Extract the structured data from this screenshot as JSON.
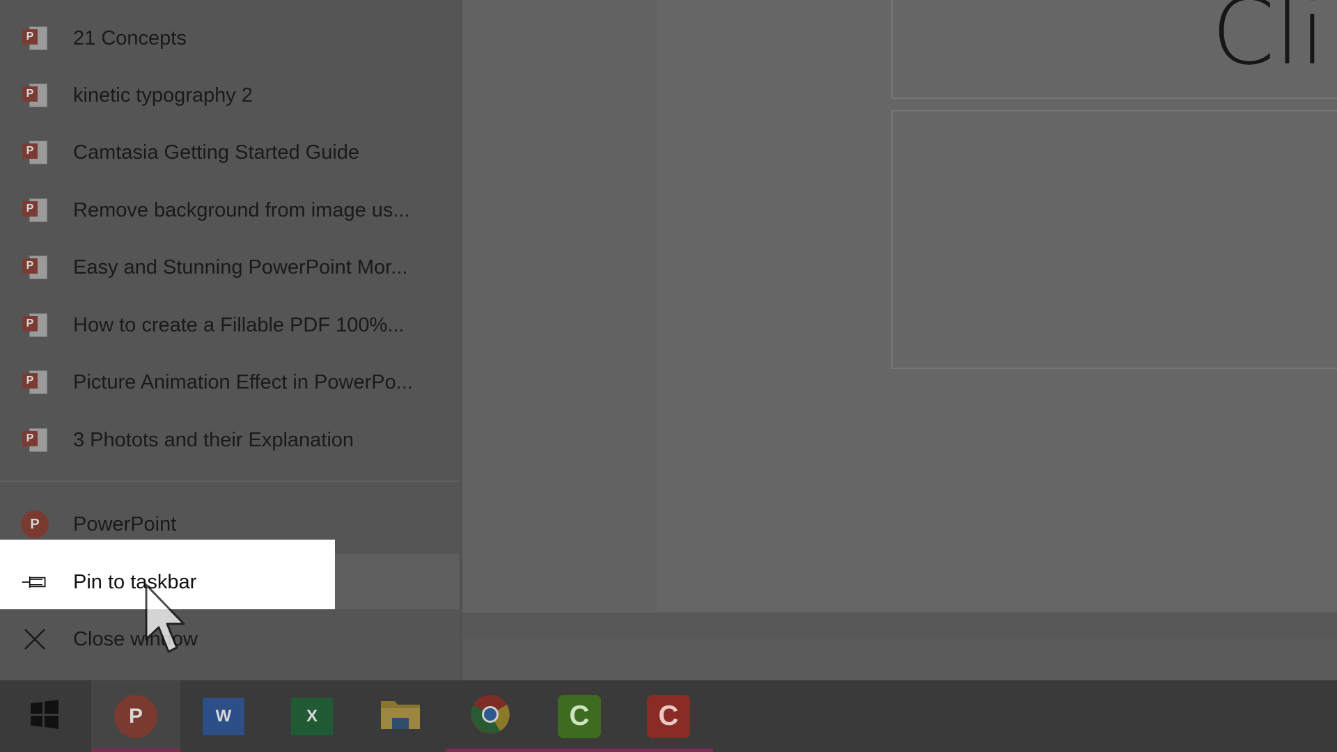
{
  "slide": {
    "title_fragment": "Cli"
  },
  "jumplist": {
    "recent": [
      {
        "label": "21 Concepts"
      },
      {
        "label": "kinetic typography 2"
      },
      {
        "label": "Camtasia Getting Started Guide"
      },
      {
        "label": "Remove background from image us..."
      },
      {
        "label": "Easy and Stunning PowerPoint Mor..."
      },
      {
        "label": "How to create a Fillable PDF 100%..."
      },
      {
        "label": "Picture Animation Effect in PowerPo..."
      },
      {
        "label": "3 Photots and their Explanation"
      }
    ],
    "app_label": "PowerPoint",
    "pin_label": "Pin to taskbar",
    "close_label": "Close window"
  },
  "taskbar": {
    "items": [
      {
        "name": "start",
        "icon": "windows-logo-icon"
      },
      {
        "name": "powerpoint",
        "icon": "powerpoint-icon",
        "letter": "P"
      },
      {
        "name": "word",
        "icon": "word-icon",
        "letter": "W"
      },
      {
        "name": "excel",
        "icon": "excel-icon",
        "letter": "X"
      },
      {
        "name": "file-explorer",
        "icon": "folder-icon"
      },
      {
        "name": "chrome",
        "icon": "chrome-icon"
      },
      {
        "name": "camtasia-green",
        "icon": "camtasia-icon",
        "letter": "C"
      },
      {
        "name": "camtasia-red",
        "icon": "camtasia-recorder-icon",
        "letter": "C"
      }
    ]
  },
  "colors": {
    "taskbar_indicator": "#7a2d52",
    "powerpoint": "#7b3a30",
    "word": "#2b4f86",
    "excel": "#1f5a35",
    "camtasia_green": "#3d6b1f",
    "camtasia_red": "#8a2c25"
  }
}
